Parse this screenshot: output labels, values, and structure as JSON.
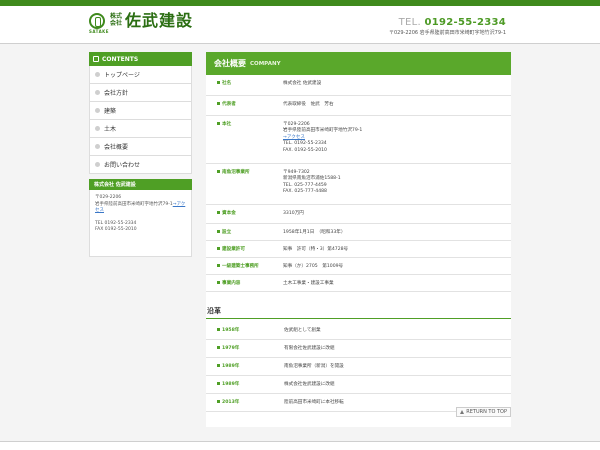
{
  "header": {
    "logo_en": "SATAKE",
    "logo_kabu1": "株式",
    "logo_kabu2": "会社",
    "logo_name": "佐武建設",
    "tel_prefix": "TEL.",
    "tel": "0192-55-2334",
    "address": "〒029-2206 岩手県陸前高田市米崎町字地竹沢79-1"
  },
  "sidebar": {
    "title": "CONTENTS",
    "items": [
      {
        "label": "トップページ"
      },
      {
        "label": "会社方針"
      },
      {
        "label": "建築"
      },
      {
        "label": "土木"
      },
      {
        "label": "会社概要"
      },
      {
        "label": "お問い合わせ"
      }
    ],
    "info_title": "株式会社 佐武建設",
    "info_postal": "〒029-2206",
    "info_addr": "岩手県陸前高田市米崎町字地竹沢79-1",
    "info_link": "→アクセス",
    "info_tel": "TEL 0192-55-2334",
    "info_fax": "FAX 0192-55-2010"
  },
  "main": {
    "title": "会社概要",
    "title_en": "COMPANY",
    "rows": [
      {
        "label": "社名",
        "lines": [
          "株式会社 佐武建設"
        ]
      },
      {
        "label": "代表者",
        "lines": [
          "代表取締役　佐武　芳右"
        ]
      },
      {
        "label": "本社",
        "lines": [
          "〒029-2206",
          "岩手県陸前高田市米崎町字地竹沢79-1",
          "→アクセス",
          "TEL. 0192-55-2334",
          "FAX. 0192-55-2010"
        ]
      },
      {
        "label": "南魚沼事業所",
        "lines": [
          "〒949-7302",
          "新潟県南魚沼市浦佐1588-1",
          "TEL. 025-777-4459",
          "FAX. 025-777-4488"
        ]
      },
      {
        "label": "資本金",
        "lines": [
          "3310万円"
        ]
      },
      {
        "label": "設立",
        "lines": [
          "1958年1月1日　（昭和33年）"
        ]
      },
      {
        "label": "建設業許可",
        "lines": [
          "知事　許可（特・3）第4728号"
        ]
      },
      {
        "label": "一級建築士事務所",
        "lines": [
          "知事（か）2705　第1009号"
        ]
      },
      {
        "label": "事業内容",
        "lines": [
          "土木工事業・建設工事業"
        ]
      }
    ],
    "history_title": "沿革",
    "history": [
      {
        "year": "1958年",
        "text": "佐武組として創業"
      },
      {
        "year": "1979年",
        "text": "有限会社佐武建設に改組"
      },
      {
        "year": "1989年",
        "text": "南魚沼事業所（新潟）を開設"
      },
      {
        "year": "1989年",
        "text": "株式会社佐武建設に改組"
      },
      {
        "year": "2013年",
        "text": "陸前高田市米崎町に本社移転"
      }
    ],
    "return_label": "RETURN TO TOP"
  }
}
